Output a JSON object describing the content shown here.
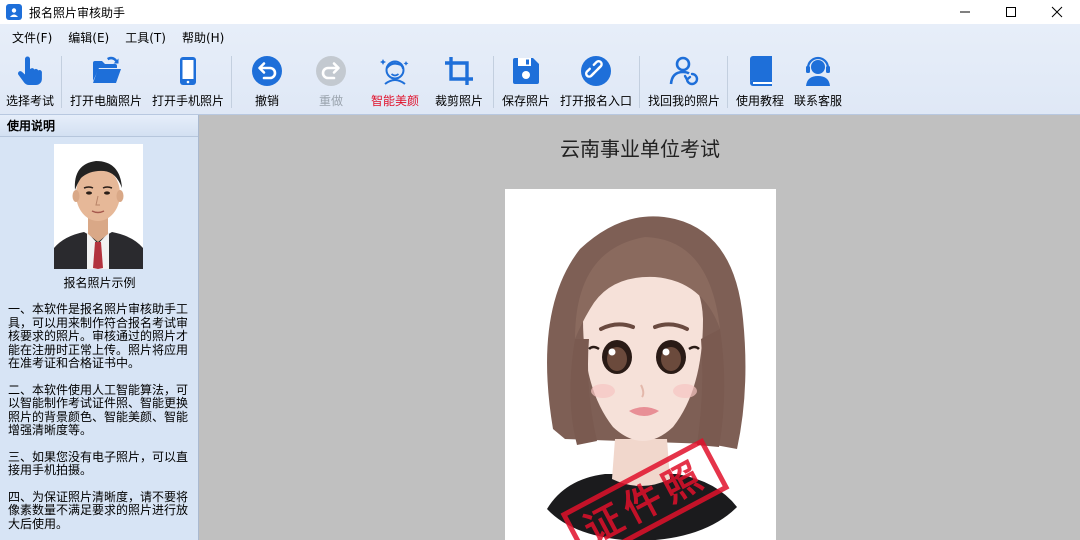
{
  "window": {
    "title": "报名照片审核助手"
  },
  "menu": [
    "文件(F)",
    "编辑(E)",
    "工具(T)",
    "帮助(H)"
  ],
  "toolbar": [
    {
      "label": "选择考试",
      "icon": "hand-pointer-icon"
    },
    {
      "label": "打开电脑照片",
      "icon": "folder-open-icon"
    },
    {
      "label": "打开手机照片",
      "icon": "phone-icon"
    },
    {
      "label": "撤销",
      "icon": "undo-icon"
    },
    {
      "label": "重做",
      "icon": "redo-icon",
      "disabled": true
    },
    {
      "label": "智能美颜",
      "icon": "beauty-face-icon",
      "accent": true
    },
    {
      "label": "裁剪照片",
      "icon": "crop-icon"
    },
    {
      "label": "保存照片",
      "icon": "save-icon"
    },
    {
      "label": "打开报名入口",
      "icon": "link-icon"
    },
    {
      "label": "找回我的照片",
      "icon": "user-retrieve-icon"
    },
    {
      "label": "使用教程",
      "icon": "book-icon"
    },
    {
      "label": "联系客服",
      "icon": "headset-icon"
    }
  ],
  "sidebar": {
    "header": "使用说明",
    "sample_caption": "报名照片示例",
    "paragraphs": [
      "一、本软件是报名照片审核助手工具，可以用来制作符合报名考试审核要求的照片。审核通过的照片才能在注册时正常上传。照片将应用在准考证和合格证书中。",
      "二、本软件使用人工智能算法，可以智能制作考试证件照、智能更换照片的背景颜色、智能美颜、智能增强清晰度等。",
      "三、如果您没有电子照片，可以直接用手机拍摄。",
      "四、为保证照片清晰度，请不要将像素数量不满足要求的照片进行放大后使用。"
    ]
  },
  "main": {
    "exam_title": "云南事业单位考试",
    "stamp_text": "证件照"
  },
  "colors": {
    "accent": "#e0102a",
    "icon_blue": "#1e6fd9",
    "disabled": "#9aa3ad"
  }
}
